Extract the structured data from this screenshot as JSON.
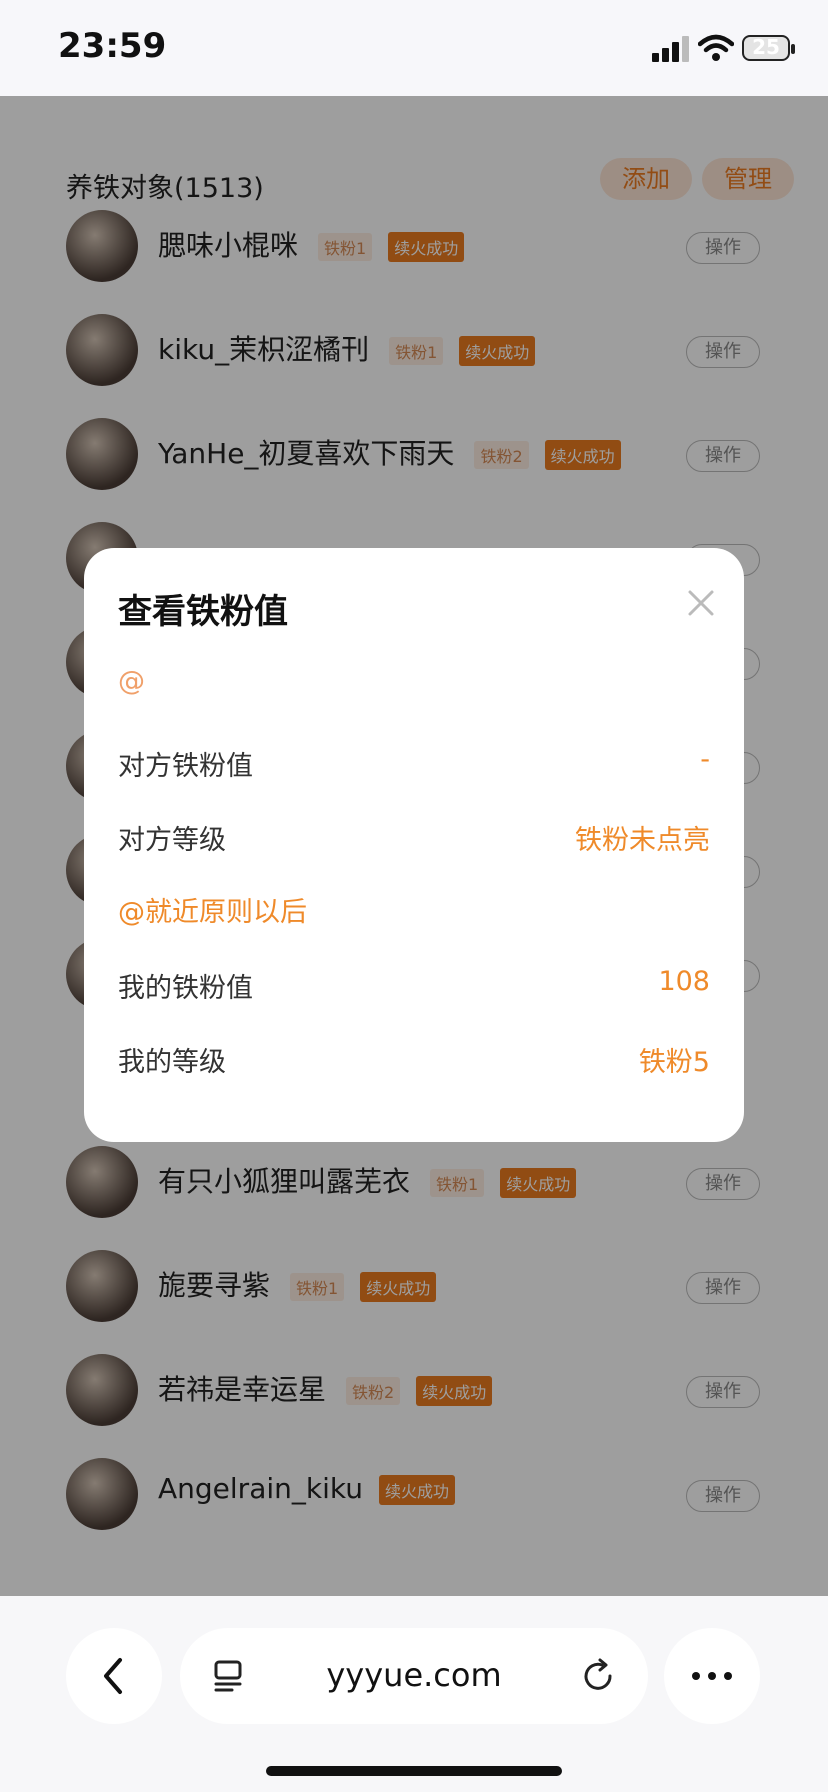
{
  "status": {
    "time": "23:59",
    "battery": "25"
  },
  "list": {
    "title": "养铁对象(1513)",
    "add_label": "添加",
    "manage_label": "管理",
    "items": [
      {
        "name": "腮味小棍咪",
        "level": "铁粉1",
        "status": "续火成功",
        "action": "操作"
      },
      {
        "name": "kiku_茉枳涩橘刊",
        "level": "铁粉1",
        "status": "续火成功",
        "action": "操作"
      },
      {
        "name": "YanHe_初夏喜欢下雨天",
        "level": "铁粉2",
        "status": "续火成功",
        "action": "操作"
      },
      {
        "name": "有只小狐狸叫露芜衣",
        "level": "铁粉1",
        "status": "续火成功",
        "action": "操作"
      },
      {
        "name": "旎要寻紫",
        "level": "铁粉1",
        "status": "续火成功",
        "action": "操作"
      },
      {
        "name": "若祎是幸运星",
        "level": "铁粉2",
        "status": "续火成功",
        "action": "操作"
      },
      {
        "name": "Angelrain_kiku",
        "level": "",
        "status": "续火成功",
        "action": "操作"
      }
    ]
  },
  "modal": {
    "title": "查看铁粉值",
    "target_handle": "@",
    "their_value_label": "对方铁粉值",
    "their_value": "-",
    "their_level_label": "对方等级",
    "their_level": "铁粉未点亮",
    "my_handle": "@就近原则以后",
    "my_value_label": "我的铁粉值",
    "my_value": "108",
    "my_level_label": "我的等级",
    "my_level": "铁粉5"
  },
  "browser": {
    "url": "yyyue.com"
  }
}
